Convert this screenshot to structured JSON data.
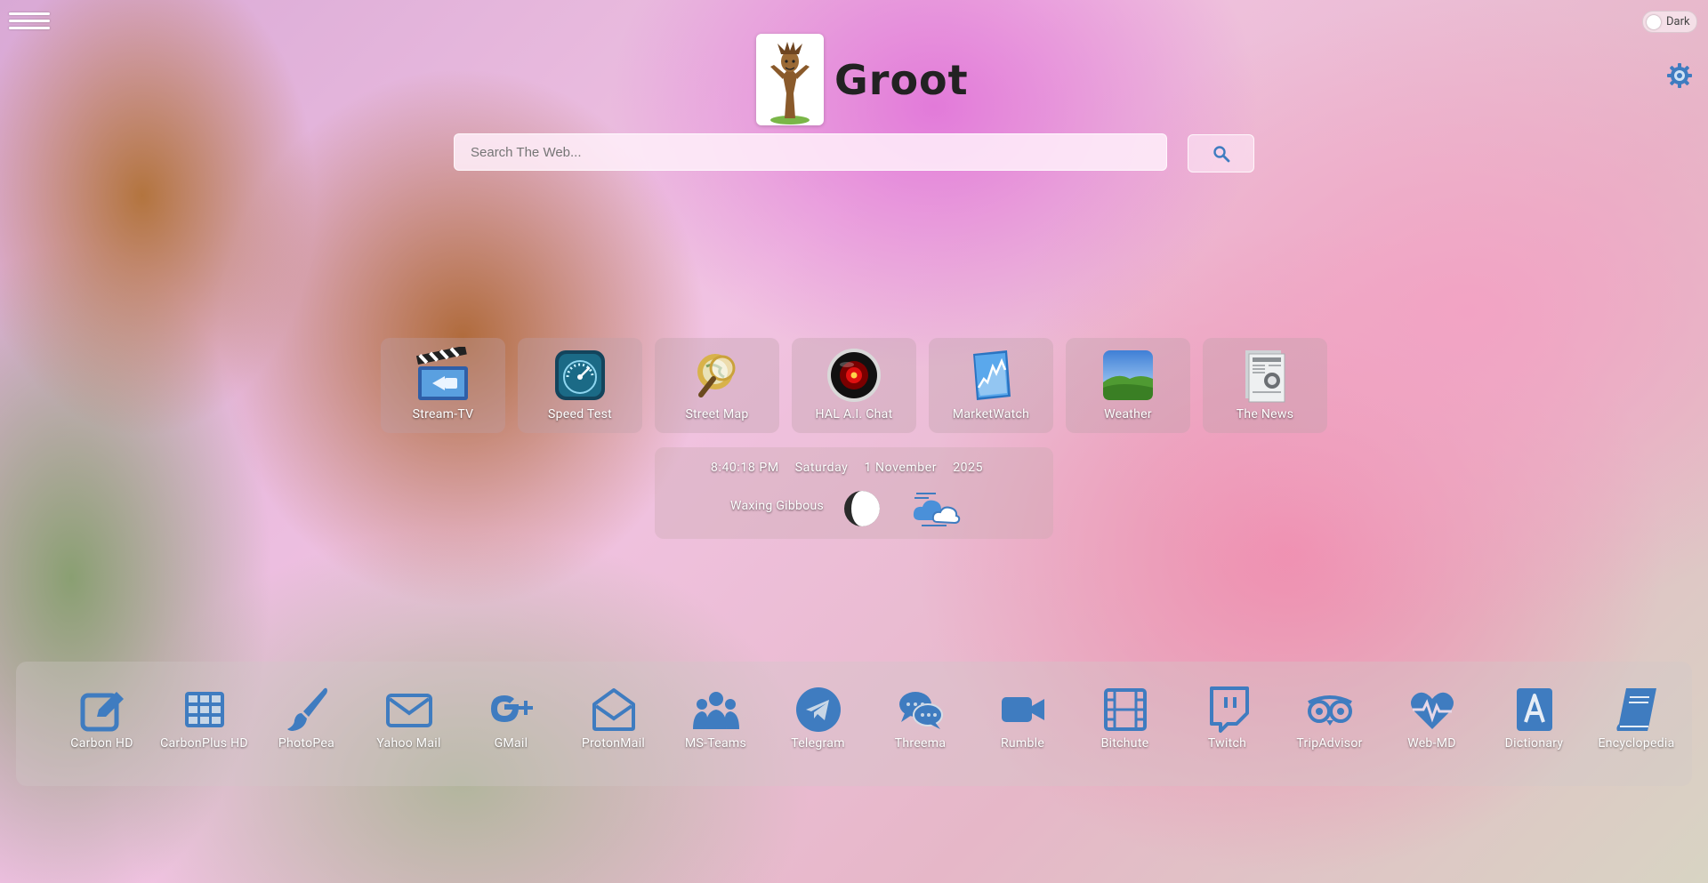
{
  "header": {
    "title": "Groot",
    "dark_label": "Dark"
  },
  "search": {
    "placeholder": "Search The Web..."
  },
  "tiles": [
    {
      "label": "Stream-TV",
      "icon": "clapperboard-icon"
    },
    {
      "label": "Speed Test",
      "icon": "speedometer-icon"
    },
    {
      "label": "Street Map",
      "icon": "magnifier-globe-icon"
    },
    {
      "label": "HAL A.I. Chat",
      "icon": "hal-eye-icon"
    },
    {
      "label": "MarketWatch",
      "icon": "stock-chart-icon"
    },
    {
      "label": "Weather",
      "icon": "landscape-icon"
    },
    {
      "label": "The News",
      "icon": "newspaper-icon"
    }
  ],
  "info": {
    "time": "8:40:18 PM",
    "day": "Saturday",
    "date": "1 November",
    "year": "2025",
    "moon_phase": "Waxing Gibbous"
  },
  "dock": [
    {
      "label": "Carbon HD",
      "icon": "pencil-square-icon"
    },
    {
      "label": "CarbonPlus HD",
      "icon": "grid-icon"
    },
    {
      "label": "PhotoPea",
      "icon": "paintbrush-icon"
    },
    {
      "label": "Yahoo Mail",
      "icon": "envelope-icon"
    },
    {
      "label": "GMail",
      "icon": "google-plus-icon"
    },
    {
      "label": "ProtonMail",
      "icon": "envelope-open-icon"
    },
    {
      "label": "MS-Teams",
      "icon": "users-icon"
    },
    {
      "label": "Telegram",
      "icon": "telegram-icon"
    },
    {
      "label": "Threema",
      "icon": "chat-bubbles-icon"
    },
    {
      "label": "Rumble",
      "icon": "video-camera-icon"
    },
    {
      "label": "Bitchute",
      "icon": "film-icon"
    },
    {
      "label": "Twitch",
      "icon": "twitch-icon"
    },
    {
      "label": "TripAdvisor",
      "icon": "tripadvisor-icon"
    },
    {
      "label": "Web-MD",
      "icon": "heartbeat-icon"
    },
    {
      "label": "Dictionary",
      "icon": "dictionary-icon"
    },
    {
      "label": "Encyclopedia",
      "icon": "book-icon"
    }
  ],
  "colors": {
    "dock_icon": "#3f7cc0",
    "text_light": "#ffffff"
  }
}
